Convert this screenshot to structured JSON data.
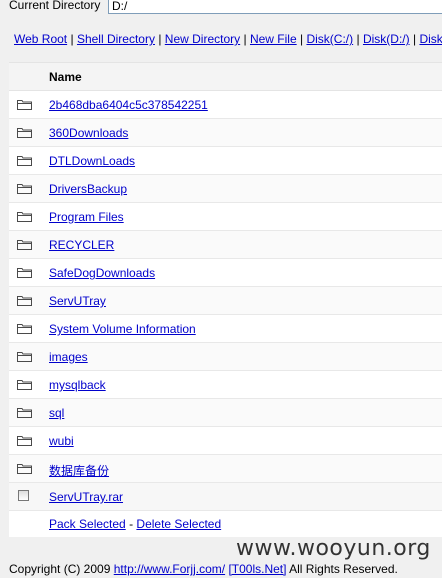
{
  "directory": {
    "label": "Current Directory",
    "value": "D:/"
  },
  "nav": {
    "links": [
      "Web Root",
      "Shell Directory",
      "New Directory",
      "New File",
      "Disk(C:/)",
      "Disk(D:/)",
      "Disk"
    ],
    "separator": "|"
  },
  "table": {
    "header": "Name",
    "folders": [
      "2b468dba6404c5c378542251",
      "360Downloads",
      "DTLDownLoads",
      "DriversBackup",
      "Program Files",
      "RECYCLER",
      "SafeDogDownloads",
      "ServUTray",
      "System Volume Information",
      "images",
      "mysqlback",
      "sql",
      "wubi",
      "数据库备份"
    ],
    "files": [
      "ServUTray.rar"
    ],
    "actions": {
      "pack": "Pack Selected",
      "separator": "-",
      "delete": "Delete Selected"
    }
  },
  "footer": {
    "copyright": "Copyright (C) 2009",
    "link1": "http://www.Forjj.com/",
    "link2": "[T00ls.Net]",
    "rights": "All Rights Reserved."
  },
  "watermark": "www.wooyun.org",
  "colors": {
    "link": "#0000cc",
    "folder": "#4a4a4a"
  }
}
